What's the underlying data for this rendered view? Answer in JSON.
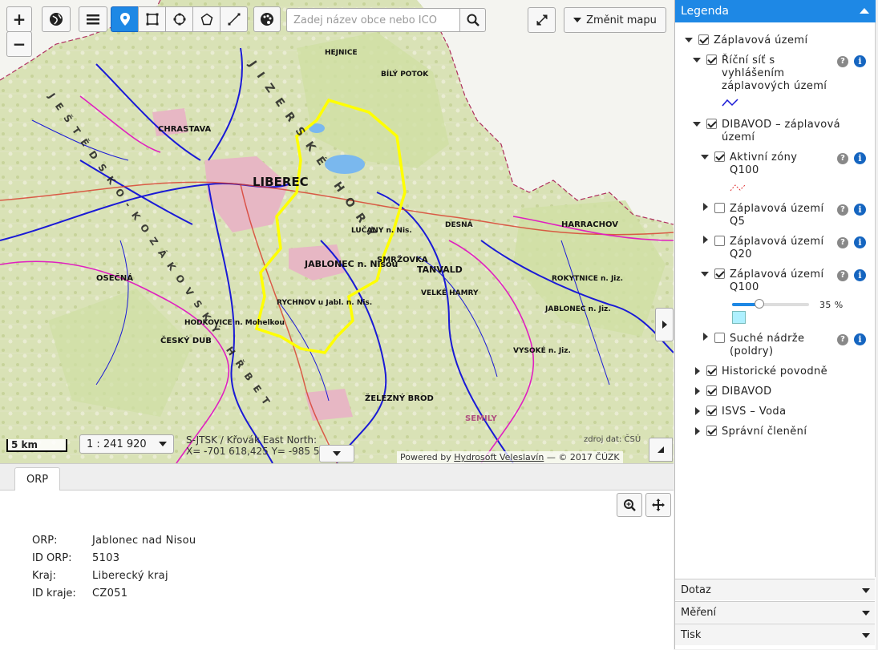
{
  "map": {
    "search": {
      "placeholder": "Zadej název obce nebo IČO"
    },
    "change_map_label": "Změnit mapu",
    "scale_bar_label": "5 km",
    "scale_select_value": "1 : 241 920",
    "coords": {
      "line1": "S-JTSK / Křovák East North:",
      "line2": "X= -701 618,425 Y= -985 54..."
    },
    "attribution_prefix": "Powered by ",
    "attribution_link": "Hydrosoft Veleslavín",
    "attribution_suffix": " — © 2017 ČÚZK",
    "czso_label": "zdroj dat: ČSÚ",
    "place_labels": [
      "LIBEREC",
      "JABLONEC n. Nisou",
      "CHRASTAVA",
      "HODKOVICE n. Mohelkou",
      "ČESKÝ DUB",
      "TANVALD",
      "SMRŽOVKA",
      "LUČANY n. Nis.",
      "RYCHNOV u Jabl. n. Nis.",
      "HARRACHOV",
      "ROKYTNICE n. Jiz.",
      "JABLONEC n. Jiz.",
      "VYSOKÉ n. Jiz.",
      "VELKÉ HAMRY",
      "ŽELEZNÝ BROD",
      "SEMILY",
      "HEJNICE",
      "BÍLÝ POTOK",
      "OSEČNÁ",
      "DESNÁ",
      "JIZERSKÉ HORY",
      "JEŠTĚDSKO-KOZÁKOVSKÝ HŘBET"
    ]
  },
  "bottom": {
    "tab_label": "ORP",
    "rows": [
      {
        "key": "ORP:",
        "value": "Jablonec nad Nisou"
      },
      {
        "key": "ID ORP:",
        "value": "5103"
      },
      {
        "key": "Kraj:",
        "value": "Liberecký kraj"
      },
      {
        "key": "ID kraje:",
        "value": "CZ051"
      }
    ]
  },
  "legend": {
    "title": "Legenda",
    "root": "Záplavová území",
    "river_net": [
      "Říční síť s",
      "vyhlášením",
      "záplavových území"
    ],
    "dibavod_zap": [
      "DIBAVOD – záplavová",
      "území"
    ],
    "aktivni": [
      "Aktivní zóny",
      "Q100"
    ],
    "q5": [
      "Záplavová území",
      "Q5"
    ],
    "q20": [
      "Záplavová území",
      "Q20"
    ],
    "q100": [
      "Záplavová území",
      "Q100"
    ],
    "opacity_percent": 35,
    "opacity_label": "35 %",
    "suche": [
      "Suché nádrže",
      "(poldry)"
    ],
    "historicke": "Historické povodně",
    "dibavod": "DIBAVOD",
    "isvs": "ISVS – Voda",
    "spravni": "Správní členění",
    "sections": [
      "Dotaz",
      "Měření",
      "Tisk"
    ]
  },
  "colors": {
    "accent": "#1e88e5",
    "district_boundary": "#ffff00",
    "rivers": "#1a1ad6",
    "regional_boundary": "#e020c0"
  }
}
